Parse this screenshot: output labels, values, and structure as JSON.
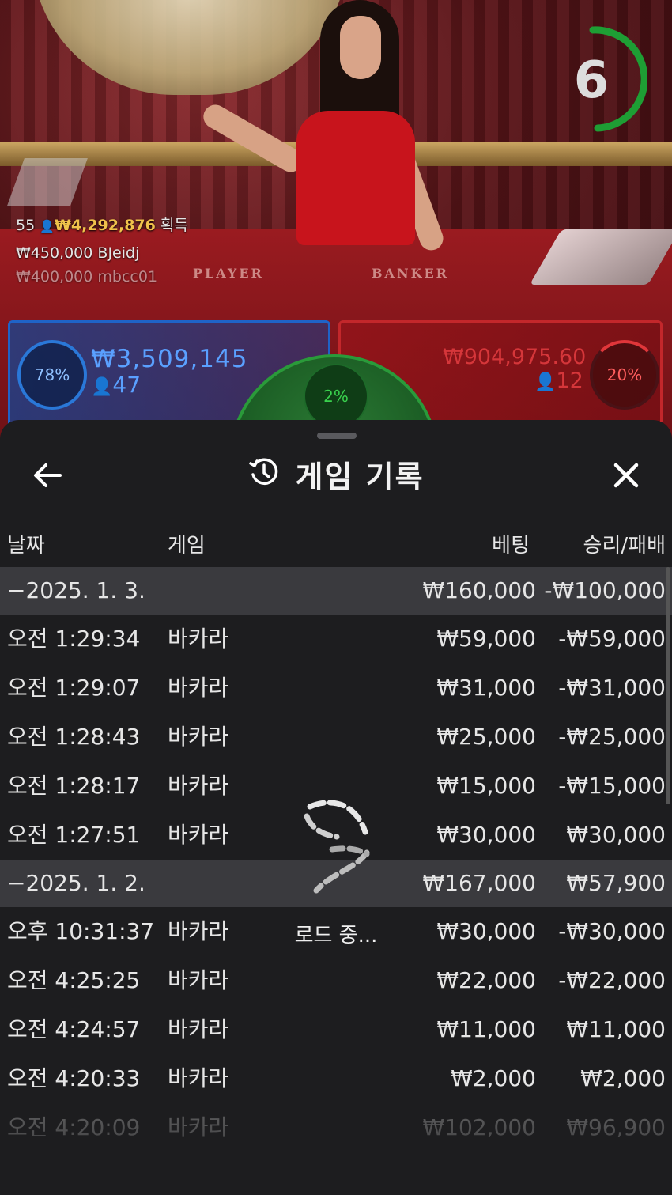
{
  "video": {
    "timer": "6",
    "table_labels": {
      "player": "PLAYER",
      "banker": "BANKER"
    },
    "winners": {
      "summary": {
        "count": "55",
        "amount": "₩4,292,876",
        "label": "획득"
      },
      "entries": [
        {
          "amount": "₩450,000",
          "name": "BJeidj"
        },
        {
          "amount": "₩400,000",
          "name": "mbcc01"
        }
      ]
    },
    "bets": {
      "player": {
        "percent": "78%",
        "amount": "₩3,509,145",
        "count": "47"
      },
      "tie": {
        "percent": "2%"
      },
      "banker": {
        "percent": "20%",
        "amount": "₩904,975.60",
        "count": "12"
      }
    }
  },
  "sheet": {
    "title": "게임 기록",
    "icons": {
      "back": "arrow-left-icon",
      "history": "history-clock-icon",
      "close": "close-icon",
      "loading": "loading-spinner-icon"
    },
    "columns": {
      "date": "날짜",
      "game": "게임",
      "bet": "베팅",
      "win_loss": "승리/패배"
    },
    "rows": [
      {
        "type": "group",
        "date": "−2025. 1. 3.",
        "game": "",
        "bet": "₩160,000",
        "win_loss": "-₩100,000"
      },
      {
        "type": "item",
        "date": "오전 1:29:34",
        "game": "바카라",
        "bet": "₩59,000",
        "win_loss": "-₩59,000"
      },
      {
        "type": "item",
        "date": "오전 1:29:07",
        "game": "바카라",
        "bet": "₩31,000",
        "win_loss": "-₩31,000"
      },
      {
        "type": "item",
        "date": "오전 1:28:43",
        "game": "바카라",
        "bet": "₩25,000",
        "win_loss": "-₩25,000"
      },
      {
        "type": "item",
        "date": "오전 1:28:17",
        "game": "바카라",
        "bet": "₩15,000",
        "win_loss": "-₩15,000"
      },
      {
        "type": "item",
        "date": "오전 1:27:51",
        "game": "바카라",
        "bet": "₩30,000",
        "win_loss": "₩30,000"
      },
      {
        "type": "group",
        "date": "−2025. 1. 2.",
        "game": "",
        "bet": "₩167,000",
        "win_loss": "₩57,900"
      },
      {
        "type": "item",
        "date": "오후 10:31:37",
        "game": "바카라",
        "bet": "₩30,000",
        "win_loss": "-₩30,000"
      },
      {
        "type": "item",
        "date": "오전 4:25:25",
        "game": "바카라",
        "bet": "₩22,000",
        "win_loss": "-₩22,000"
      },
      {
        "type": "item",
        "date": "오전 4:24:57",
        "game": "바카라",
        "bet": "₩11,000",
        "win_loss": "₩11,000"
      },
      {
        "type": "item",
        "date": "오전 4:20:33",
        "game": "바카라",
        "bet": "₩2,000",
        "win_loss": "₩2,000"
      },
      {
        "type": "item",
        "date": "오전 4:20:09",
        "game": "바카라",
        "bet": "₩102,000",
        "win_loss": "₩96,900"
      }
    ],
    "loading_text": "로드 중..."
  }
}
